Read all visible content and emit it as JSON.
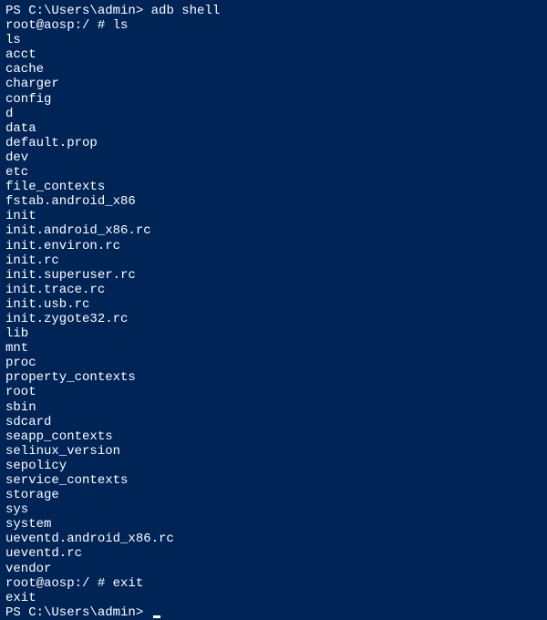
{
  "lines": [
    {
      "prompt": "PS C:\\Users\\admin>",
      "cmd": " adb shell"
    },
    {
      "prompt": "root@aosp:/ #",
      "cmd": " ls"
    },
    {
      "text": "ls"
    },
    {
      "text": "acct"
    },
    {
      "text": "cache"
    },
    {
      "text": "charger"
    },
    {
      "text": "config"
    },
    {
      "text": "d"
    },
    {
      "text": "data"
    },
    {
      "text": "default.prop"
    },
    {
      "text": "dev"
    },
    {
      "text": "etc"
    },
    {
      "text": "file_contexts"
    },
    {
      "text": "fstab.android_x86"
    },
    {
      "text": "init"
    },
    {
      "text": "init.android_x86.rc"
    },
    {
      "text": "init.environ.rc"
    },
    {
      "text": "init.rc"
    },
    {
      "text": "init.superuser.rc"
    },
    {
      "text": "init.trace.rc"
    },
    {
      "text": "init.usb.rc"
    },
    {
      "text": "init.zygote32.rc"
    },
    {
      "text": "lib"
    },
    {
      "text": "mnt"
    },
    {
      "text": "proc"
    },
    {
      "text": "property_contexts"
    },
    {
      "text": "root"
    },
    {
      "text": "sbin"
    },
    {
      "text": "sdcard"
    },
    {
      "text": "seapp_contexts"
    },
    {
      "text": "selinux_version"
    },
    {
      "text": "sepolicy"
    },
    {
      "text": "service_contexts"
    },
    {
      "text": "storage"
    },
    {
      "text": "sys"
    },
    {
      "text": "system"
    },
    {
      "text": "ueventd.android_x86.rc"
    },
    {
      "text": "ueventd.rc"
    },
    {
      "text": "vendor"
    },
    {
      "prompt": "root@aosp:/ #",
      "cmd": " exit"
    },
    {
      "text": "exit"
    },
    {
      "prompt": "PS C:\\Users\\admin>",
      "cmd": " ",
      "cursor": true
    }
  ]
}
